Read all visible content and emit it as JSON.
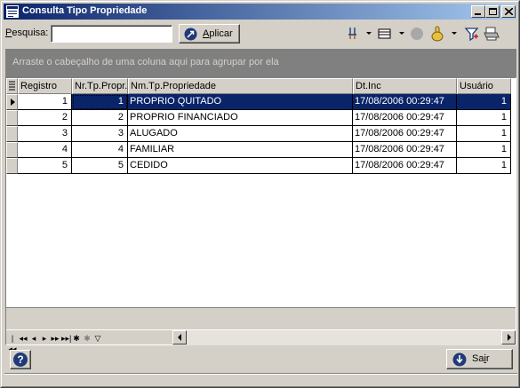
{
  "window": {
    "title": "Consulta Tipo Propriedade",
    "icon": "form-icon"
  },
  "search": {
    "label_prefix": "P",
    "label_rest": "esquisa:",
    "value": "",
    "placeholder": ""
  },
  "toolbar": {
    "apply_label_prefix": "A",
    "apply_label_rest": "plicar",
    "tools": [
      "column-chooser-icon",
      "band-layout-icon",
      "record-icon",
      "hand-tool-icon",
      "filter-icon",
      "print-icon"
    ]
  },
  "group_panel": {
    "text": "Arraste o cabeçalho de uma coluna aqui para agrupar por ela"
  },
  "grid": {
    "columns": [
      "Registro",
      "Nr.Tp.Propr.",
      "Nm.Tp.Propriedade",
      "Dt.Inc",
      "Usuário"
    ],
    "rows": [
      {
        "registro": "1",
        "nr": "1",
        "nome": "PROPRIO QUITADO",
        "dt": "17/08/2006 00:29:47",
        "usuario": "1",
        "selected": true
      },
      {
        "registro": "2",
        "nr": "2",
        "nome": "PROPRIO FINANCIADO",
        "dt": "17/08/2006 00:29:47",
        "usuario": "1",
        "selected": false
      },
      {
        "registro": "3",
        "nr": "3",
        "nome": "ALUGADO",
        "dt": "17/08/2006 00:29:47",
        "usuario": "1",
        "selected": false
      },
      {
        "registro": "4",
        "nr": "4",
        "nome": "FAMILIAR",
        "dt": "17/08/2006 00:29:47",
        "usuario": "1",
        "selected": false
      },
      {
        "registro": "5",
        "nr": "5",
        "nome": "CEDIDO",
        "dt": "17/08/2006 00:29:47",
        "usuario": "1",
        "selected": false
      }
    ]
  },
  "navigator": {
    "icons": [
      "first-page-icon",
      "prev-page-icon",
      "prev-record-icon",
      "next-record-icon",
      "next-page-icon",
      "last-record-icon",
      "insert-icon",
      "delete-icon",
      "filter-icon"
    ]
  },
  "footer": {
    "exit_label_prefix": "Sa",
    "exit_label_underline": "i",
    "exit_label_rest": "r"
  },
  "colors": {
    "selection": "#0a246a",
    "titlebar_start": "#0a246a",
    "titlebar_end": "#a6caf0",
    "face": "#d4d0c8",
    "group_panel": "#808080"
  }
}
